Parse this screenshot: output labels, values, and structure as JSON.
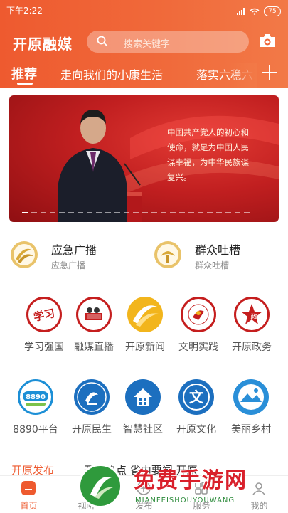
{
  "status_bar": {
    "time": "下午2:22",
    "battery": "75"
  },
  "header": {
    "logo": "开原融媒",
    "search_placeholder": "搜索关键字",
    "tabs": [
      {
        "label": "推荐",
        "active": true
      },
      {
        "label": "走向我们的小康生活",
        "active": false
      },
      {
        "label": "落实六稳六",
        "active": false
      }
    ]
  },
  "banner": {
    "quote": "中国共产党人的初心和使命，就是为中国人民谋幸福，为中华民族谋复兴。"
  },
  "quick_links": [
    {
      "title": "应急广播",
      "subtitle": "应急广播"
    },
    {
      "title": "群众吐槽",
      "subtitle": "群众吐槽"
    }
  ],
  "grid": [
    {
      "label": "学习强国"
    },
    {
      "label": "融媒直播"
    },
    {
      "label": "开原新闻"
    },
    {
      "label": "文明实践"
    },
    {
      "label": "开原政务"
    },
    {
      "label": "8890平台"
    },
    {
      "label": "开原民生"
    },
    {
      "label": "智慧社区"
    },
    {
      "label": "开原文化"
    },
    {
      "label": "美丽乡村"
    }
  ],
  "section": {
    "title": "开原发布",
    "more": "开原热点  省内要闻  开原"
  },
  "bottom_nav": [
    {
      "label": "首页",
      "active": true
    },
    {
      "label": "视听",
      "active": false
    },
    {
      "label": "发布",
      "active": false
    },
    {
      "label": "服务",
      "active": false
    },
    {
      "label": "我的",
      "active": false
    }
  ],
  "watermark": {
    "title": "免费手游网",
    "subtitle": "MIANFEISHOUYOUWANG"
  },
  "colors": {
    "accent": "#ee5a2f",
    "banner_red": "#c11f20",
    "icon_blue": "#1c6fbf"
  }
}
